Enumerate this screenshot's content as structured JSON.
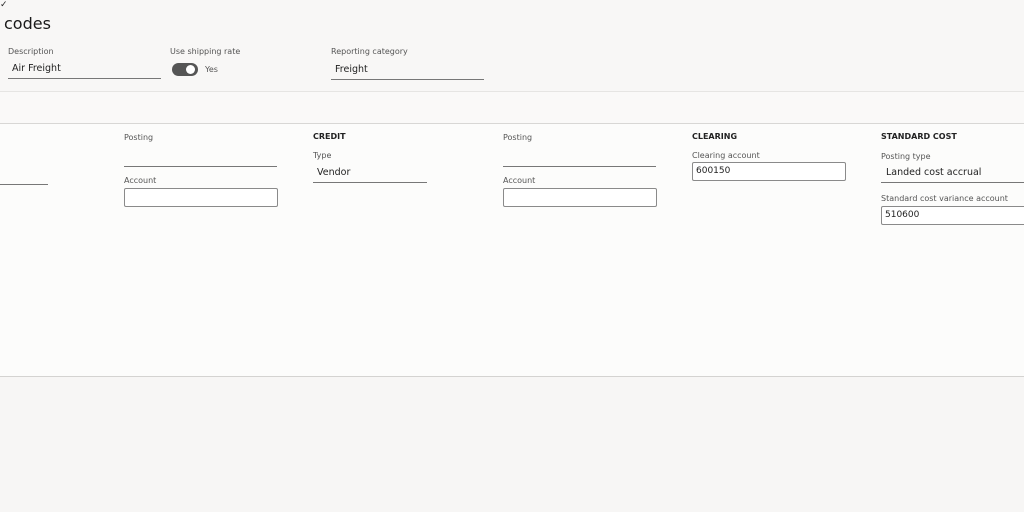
{
  "header": {
    "title": "codes",
    "description": {
      "label": "Description",
      "value": "Air Freight"
    },
    "use_shipping_rate": {
      "label": "Use shipping rate",
      "value": "Yes",
      "on": true
    },
    "reporting_category": {
      "label": "Reporting category",
      "value": "Freight"
    }
  },
  "debit": {
    "posting_label": "Posting",
    "posting_value": "",
    "account_label": "Account",
    "account_value": ""
  },
  "credit": {
    "heading": "CREDIT",
    "type_label": "Type",
    "type_value": "Vendor",
    "posting_label": "Posting",
    "posting_value": "",
    "account_label": "Account",
    "account_value": ""
  },
  "clearing": {
    "heading": "CLEARING",
    "account_label": "Clearing account",
    "account_value": "600150"
  },
  "standard_cost": {
    "heading": "STANDARD COST",
    "posting_type_label": "Posting type",
    "posting_type_value": "Landed cost accrual",
    "variance_label": "Standard cost variance account",
    "variance_value": "510600"
  }
}
